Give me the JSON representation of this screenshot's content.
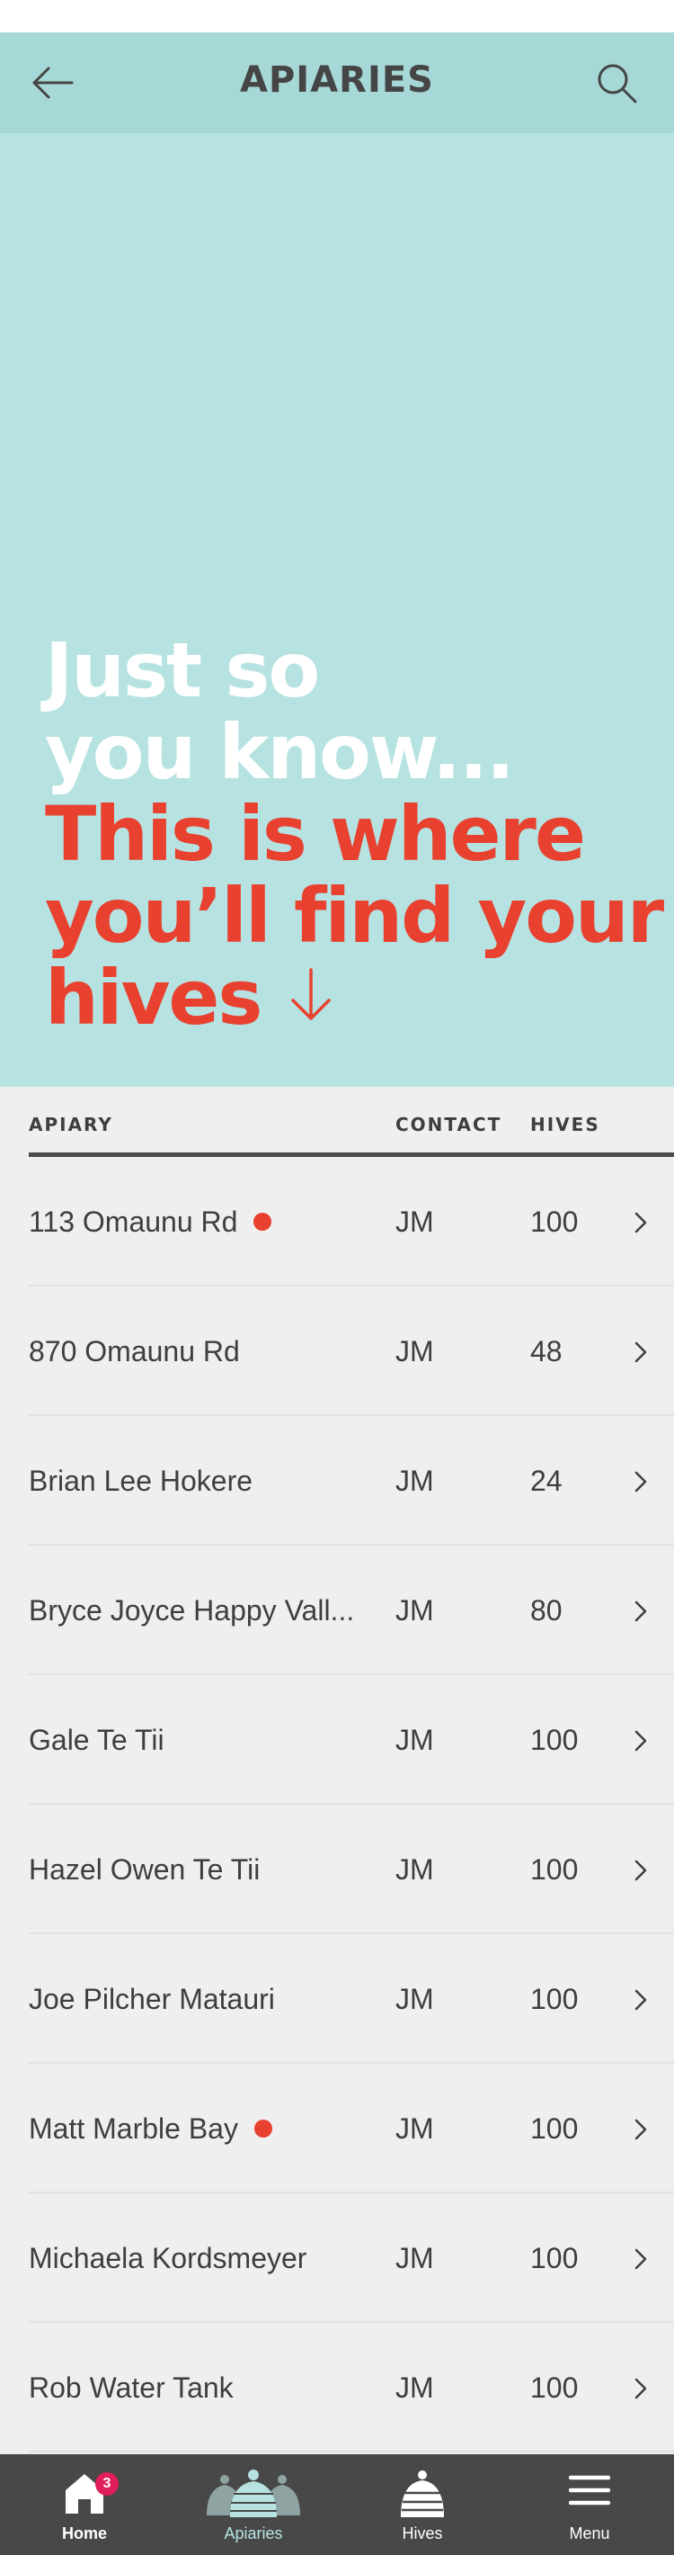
{
  "header": {
    "title": "APIARIES",
    "back_icon": "arrow-left-icon",
    "search_icon": "search-icon",
    "background": "#a7d8d8"
  },
  "hero": {
    "line1": "Just so",
    "line2": "you know...",
    "line3": "This is where",
    "line4": "you’ll find your",
    "line5": "hives",
    "arrow_icon": "arrow-down-icon",
    "background": "#b6e3e2",
    "accent": "#e8412f"
  },
  "table": {
    "columns": {
      "apiary": "APIARY",
      "contact": "CONTACT",
      "hives": "HIVES"
    },
    "rows": [
      {
        "name": "113 Omaunu Rd",
        "alert": true,
        "contact": "JM",
        "hives": "100"
      },
      {
        "name": "870 Omaunu Rd",
        "alert": false,
        "contact": "JM",
        "hives": "48"
      },
      {
        "name": "Brian Lee Hokere",
        "alert": false,
        "contact": "JM",
        "hives": "24"
      },
      {
        "name": "Bryce Joyce Happy Vall...",
        "alert": false,
        "contact": "JM",
        "hives": "80"
      },
      {
        "name": "Gale Te Tii",
        "alert": false,
        "contact": "JM",
        "hives": "100"
      },
      {
        "name": "Hazel Owen Te Tii",
        "alert": false,
        "contact": "JM",
        "hives": "100"
      },
      {
        "name": "Joe Pilcher Matauri",
        "alert": false,
        "contact": "JM",
        "hives": "100"
      },
      {
        "name": "Matt Marble Bay",
        "alert": true,
        "contact": "JM",
        "hives": "100"
      },
      {
        "name": "Michaela Kordsmeyer",
        "alert": false,
        "contact": "JM",
        "hives": "100"
      },
      {
        "name": "Rob Water Tank",
        "alert": false,
        "contact": "JM",
        "hives": "100"
      }
    ]
  },
  "tabbar": {
    "home": {
      "label": "Home",
      "badge": "3",
      "icon": "home-icon"
    },
    "apiaries": {
      "label": "Apiaries",
      "icon": "apiaries-icon",
      "active": true
    },
    "hives": {
      "label": "Hives",
      "icon": "beehive-icon"
    },
    "menu": {
      "label": "Menu",
      "icon": "hamburger-menu-icon"
    },
    "active_color": "#b6e3e2"
  }
}
